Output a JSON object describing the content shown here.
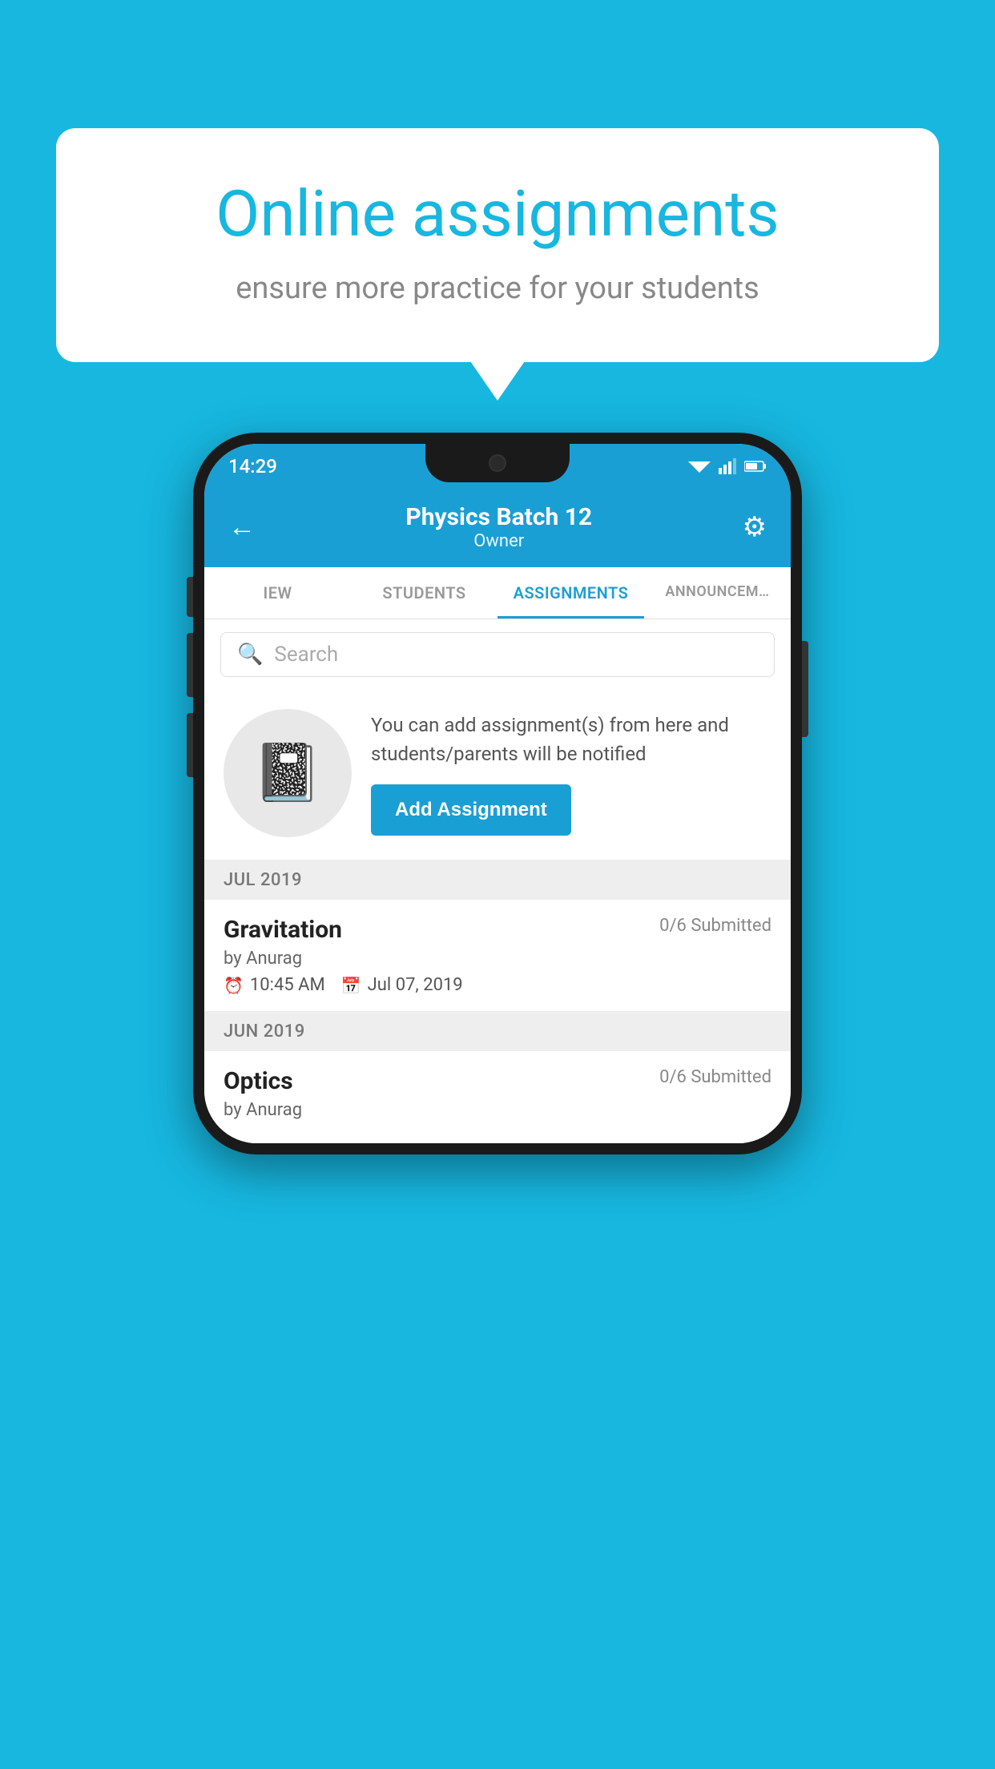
{
  "background_color": "#17b7e0",
  "speech_bubble": {
    "title": "Online assignments",
    "subtitle": "ensure more practice for your students"
  },
  "status_bar": {
    "time": "14:29"
  },
  "header": {
    "title": "Physics Batch 12",
    "subtitle": "Owner",
    "back_label": "←",
    "gear_label": "⚙"
  },
  "tabs": [
    {
      "label": "IEW",
      "active": false
    },
    {
      "label": "STUDENTS",
      "active": false
    },
    {
      "label": "ASSIGNMENTS",
      "active": true
    },
    {
      "label": "ANNOUNCEM…",
      "active": false
    }
  ],
  "search": {
    "placeholder": "Search"
  },
  "info_card": {
    "description": "You can add assignment(s) from here and students/parents will be notified",
    "button_label": "Add Assignment"
  },
  "sections": [
    {
      "label": "JUL 2019",
      "assignments": [
        {
          "name": "Gravitation",
          "submitted": "0/6 Submitted",
          "by": "by Anurag",
          "time": "10:45 AM",
          "date": "Jul 07, 2019"
        }
      ]
    },
    {
      "label": "JUN 2019",
      "assignments": [
        {
          "name": "Optics",
          "submitted": "0/6 Submitted",
          "by": "by Anurag",
          "time": "",
          "date": ""
        }
      ]
    }
  ]
}
